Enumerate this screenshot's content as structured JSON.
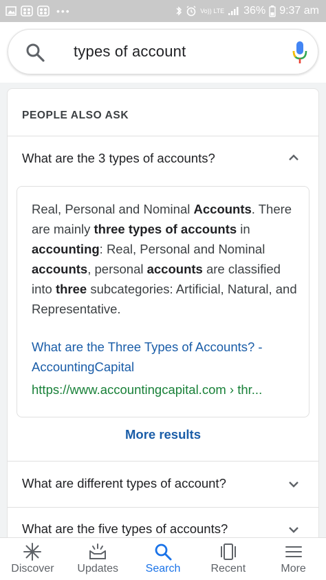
{
  "status_bar": {
    "battery_percent": "36%",
    "time": "9:37 am",
    "network_label": "Vo)) LTE",
    "lte_label": "LTE",
    "dots": "•••"
  },
  "search": {
    "query": "types of account"
  },
  "people_also_ask": {
    "header": "PEOPLE ALSO ASK",
    "questions": [
      {
        "text": "What are the 3 types of accounts?",
        "expanded": true
      },
      {
        "text": "What are different types of account?",
        "expanded": false
      },
      {
        "text": "What are the five types of accounts?",
        "expanded": false
      }
    ],
    "answer": {
      "segments": [
        {
          "text": "Real, Personal and Nominal ",
          "bold": false
        },
        {
          "text": "Accounts",
          "bold": true
        },
        {
          "text": ". There are mainly ",
          "bold": false
        },
        {
          "text": "three types of accounts",
          "bold": true
        },
        {
          "text": " in ",
          "bold": false
        },
        {
          "text": "accounting",
          "bold": true
        },
        {
          "text": ": Real, Personal and Nominal ",
          "bold": false
        },
        {
          "text": "accounts",
          "bold": true
        },
        {
          "text": ", personal ",
          "bold": false
        },
        {
          "text": "accounts",
          "bold": true
        },
        {
          "text": " are classified into ",
          "bold": false
        },
        {
          "text": "three",
          "bold": true
        },
        {
          "text": " subcategories: Artificial, Natural, and Representative.",
          "bold": false
        }
      ],
      "link_title": "What are the Three Types of Accounts? - AccountingCapital",
      "url": "https://www.accountingcapital.com › thr..."
    },
    "more_results": "More results"
  },
  "bottom_nav": {
    "items": [
      {
        "label": "Discover",
        "icon": "discover-icon",
        "active": false
      },
      {
        "label": "Updates",
        "icon": "updates-icon",
        "active": false
      },
      {
        "label": "Search",
        "icon": "search-icon",
        "active": true
      },
      {
        "label": "Recent",
        "icon": "recent-icon",
        "active": false
      },
      {
        "label": "More",
        "icon": "menu-icon",
        "active": false
      }
    ]
  },
  "colors": {
    "link": "#1a5da8",
    "url": "#188038",
    "active_nav": "#1a73e8",
    "status_bar": "#c9c9c9"
  }
}
